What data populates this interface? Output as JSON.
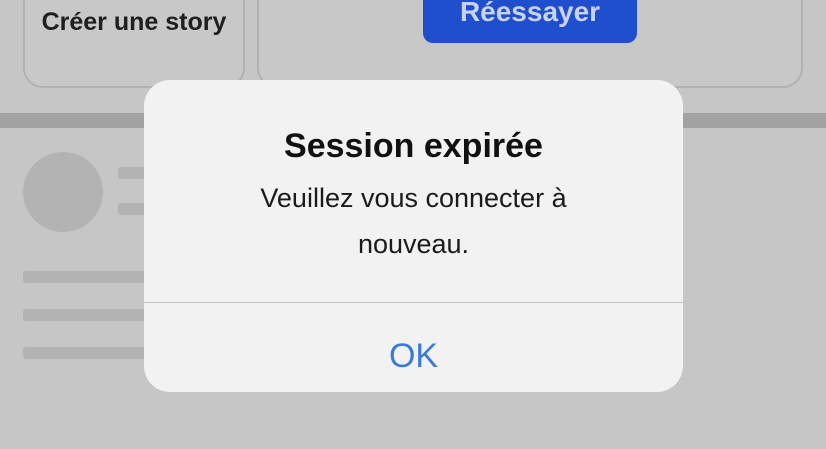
{
  "background": {
    "story_card": {
      "label": "Créer une story"
    },
    "retry_button": {
      "label": "Réessayer",
      "color": "#1f4fcc"
    }
  },
  "alert": {
    "title": "Session expirée",
    "message": "Veuillez vous connecter à nouveau.",
    "ok_label": "OK",
    "ok_color": "#3a7bd5"
  }
}
